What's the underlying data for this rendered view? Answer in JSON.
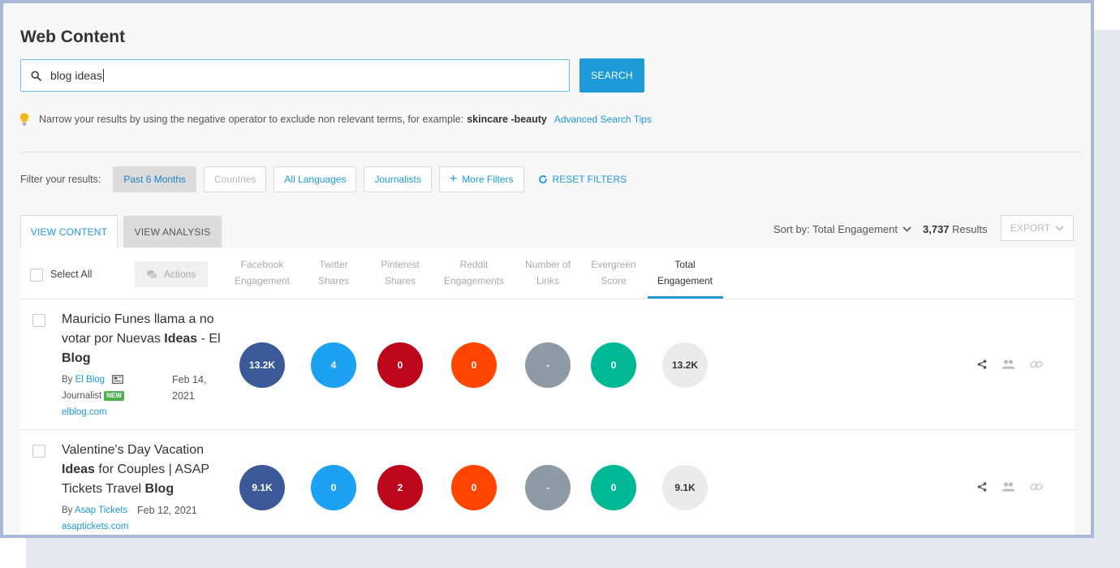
{
  "page": {
    "title": "Web Content"
  },
  "search": {
    "value": "blog ideas",
    "button_label": "SEARCH"
  },
  "tip": {
    "text": "Narrow your results by using the negative operator to exclude non relevant terms, for example:",
    "example": "skincare -beauty",
    "link": "Advanced Search Tips"
  },
  "filters": {
    "label": "Filter your results:",
    "chips": [
      "Past 6 Months",
      "Countries",
      "All Languages",
      "Journalists",
      "More Filters"
    ],
    "reset": "RESET FILTERS"
  },
  "tabs": {
    "view_content": "VIEW CONTENT",
    "view_analysis": "VIEW ANALYSIS"
  },
  "sort": {
    "label": "Sort by: Total Engagement"
  },
  "results": {
    "count": "3,737",
    "label": "Results"
  },
  "export": {
    "label": "EXPORT"
  },
  "table": {
    "select_all": "Select All",
    "actions": "Actions",
    "columns": [
      {
        "line1": "Facebook",
        "line2": "Engagement"
      },
      {
        "line1": "Twitter",
        "line2": "Shares"
      },
      {
        "line1": "Pinterest",
        "line2": "Shares"
      },
      {
        "line1": "Reddit",
        "line2": "Engagements"
      },
      {
        "line1": "Number of",
        "line2": "Links"
      },
      {
        "line1": "Evergreen",
        "line2": "Score"
      },
      {
        "line1": "Total",
        "line2": "Engagement"
      }
    ],
    "rows": [
      {
        "title_parts": [
          "Mauricio Funes llama a no votar por Nuevas ",
          "Ideas",
          " - El ",
          "Blog"
        ],
        "by": "By",
        "author": "El Blog",
        "author_type": "Journalist",
        "badge": "NEW",
        "date_line1": "Feb 14,",
        "date_line2": "2021",
        "domain": "elblog.com",
        "metrics": [
          "13.2K",
          "4",
          "0",
          "0",
          "-",
          "0"
        ],
        "total": "13.2K"
      },
      {
        "title_parts": [
          "Valentine's Day Vacation ",
          "Ideas",
          " for Couples | ASAP Tickets Travel ",
          "Blog"
        ],
        "by": "By",
        "author": "Asap Tickets",
        "date": "Feb 12, 2021",
        "domain": "asaptickets.com",
        "metrics": [
          "9.1K",
          "0",
          "2",
          "0",
          "-",
          "0"
        ],
        "total": "9.1K"
      }
    ]
  },
  "colors": {
    "accent": "#1e9bd7",
    "facebook": "#3b5998",
    "twitter": "#1da1f2",
    "pinterest": "#bd081c",
    "reddit": "#ff4500",
    "links": "#8e9aa5",
    "evergreen": "#00b894",
    "total": "#ebebeb"
  },
  "icons": {
    "search": "search-icon",
    "tip": "lightbulb-icon",
    "reset": "refresh-icon",
    "more_filters": "plus-icon",
    "actions": "comments-icon",
    "share": "share-icon",
    "people": "people-icon",
    "link": "link-icon",
    "journalist": "newspaper-icon"
  }
}
